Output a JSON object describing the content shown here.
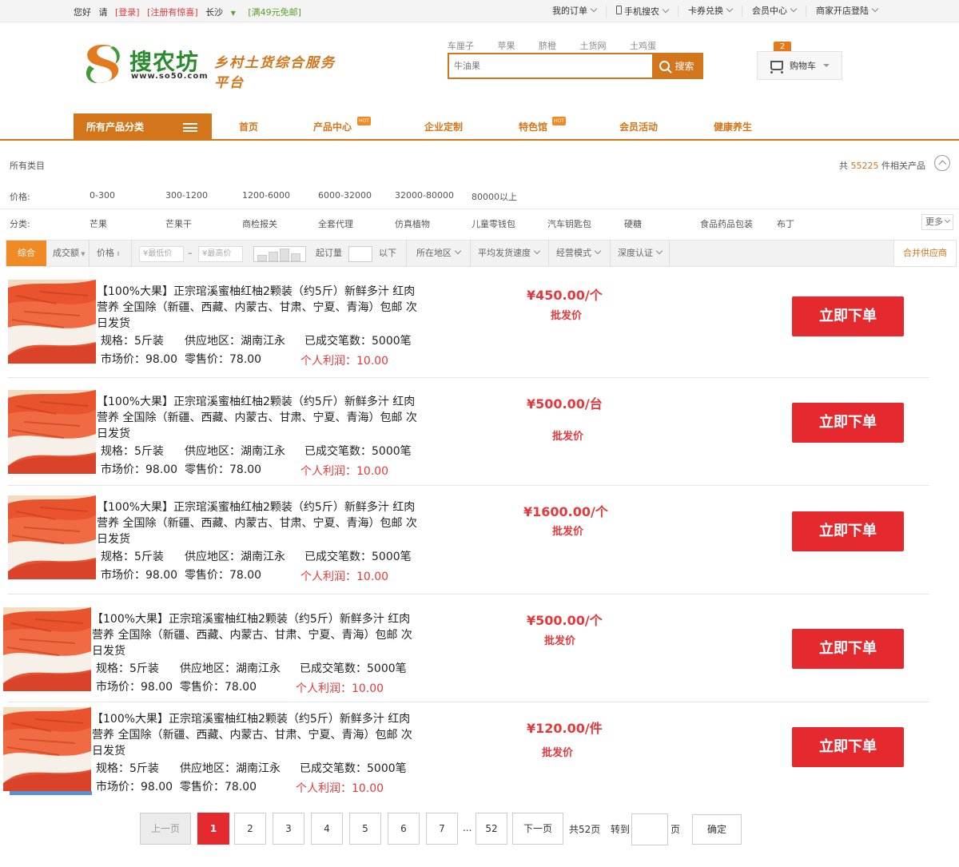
{
  "topbar": {
    "greeting": "您好",
    "please": "请",
    "login": "[登录]",
    "register": "[注册有惊喜]",
    "city": "长沙",
    "promo": "[满49元免邮]",
    "links": [
      "我的订单",
      "手机搜农",
      "卡券兑换",
      "会员中心",
      "商家开店登陆"
    ]
  },
  "brand": {
    "name": "搜农坊",
    "url": "www.so50.com",
    "slogan": "乡村土货综合服务平台"
  },
  "search": {
    "hotwords": [
      "车厘子",
      "苹果",
      "脐橙",
      "土货网",
      "土鸡蛋"
    ],
    "placeholder": "牛油果",
    "button": "搜索"
  },
  "cart": {
    "label": "购物车",
    "count": "2"
  },
  "nav": {
    "all_categories": "所有产品分类",
    "items": [
      "首页",
      "产品中心",
      "企业定制",
      "特色馆",
      "会员活动",
      "健康养生"
    ],
    "hot_badge": "HOT"
  },
  "filters": {
    "all_label": "所有类目",
    "total_prefix": "共",
    "total_count": "55225",
    "total_suffix": "件相关产品",
    "price_label": "价格:",
    "price_ranges": [
      "0-300",
      "300-1200",
      "1200-6000",
      "6000-32000",
      "32000-80000",
      "80000以上"
    ],
    "class_label": "分类:",
    "classes": [
      "芒果",
      "芒果干",
      "商检报关",
      "全套代理",
      "仿真植物",
      "儿童零钱包",
      "汽车钥匙包",
      "硬糖",
      "食品药品包装",
      "布丁"
    ],
    "more": "更多"
  },
  "sortbar": {
    "comprehensive": "综合",
    "volume": "成交额",
    "price": "价格",
    "min_price": "¥最低价",
    "dash": "–",
    "max_price": "¥最高价",
    "moq": "起订量",
    "below": "以下",
    "location": "所在地区",
    "ship_speed": "平均发货速度",
    "mode": "经营模式",
    "cert": "深度认证",
    "merge": "合并供应商"
  },
  "products": [
    {
      "title": "【100%大果】正宗琯溪蜜柚红柚2颗装（约5斤）新鲜多汁 红肉营养 全国除（新疆、西藏、内蒙古、甘肃、宁夏、青海）包邮 次日发货",
      "spec": "规格：5斤装",
      "region": "供应地区：湖南江永",
      "deals": "已成交笔数：5000笔",
      "market": "市场价：98.00",
      "retail": "零售价：78.00",
      "profit": "个人利润：10.00",
      "price": "¥450.00/个",
      "wholesale": "批发价",
      "button": "立即下单"
    },
    {
      "title": "【100%大果】正宗琯溪蜜柚红柚2颗装（约5斤）新鲜多汁 红肉营养 全国除（新疆、西藏、内蒙古、甘肃、宁夏、青海）包邮 次日发货",
      "spec": "规格：5斤装",
      "region": "供应地区：湖南江永",
      "deals": "已成交笔数：5000笔",
      "market": "市场价：98.00",
      "retail": "零售价：78.00",
      "profit": "个人利润：10.00",
      "price": "¥500.00/台",
      "wholesale": "批发价",
      "button": "立即下单"
    },
    {
      "title": "【100%大果】正宗琯溪蜜柚红柚2颗装（约5斤）新鲜多汁 红肉营养 全国除（新疆、西藏、内蒙古、甘肃、宁夏、青海）包邮 次日发货",
      "spec": "规格：5斤装",
      "region": "供应地区：湖南江永",
      "deals": "已成交笔数：5000笔",
      "market": "市场价：98.00",
      "retail": "零售价：78.00",
      "profit": "个人利润：10.00",
      "price": "¥1600.00/个",
      "wholesale": "批发价",
      "button": "立即下单"
    },
    {
      "title": "【100%大果】正宗琯溪蜜柚红柚2颗装（约5斤）新鲜多汁 红肉营养 全国除（新疆、西藏、内蒙古、甘肃、宁夏、青海）包邮 次日发货",
      "spec": "规格：5斤装",
      "region": "供应地区：湖南江永",
      "deals": "已成交笔数：5000笔",
      "market": "市场价：98.00",
      "retail": "零售价：78.00",
      "profit": "个人利润：10.00",
      "price": "¥500.00/个",
      "wholesale": "批发价",
      "button": "立即下单"
    },
    {
      "title": "【100%大果】正宗琯溪蜜柚红柚2颗装（约5斤）新鲜多汁 红肉营养 全国除（新疆、西藏、内蒙古、甘肃、宁夏、青海）包邮 次日发货",
      "spec": "规格：5斤装",
      "region": "供应地区：湖南江永",
      "deals": "已成交笔数：5000笔",
      "market": "市场价：98.00",
      "retail": "零售价：78.00",
      "profit": "个人利润：10.00",
      "price": "¥120.00/件",
      "wholesale": "批发价",
      "button": "立即下单"
    }
  ],
  "pagination": {
    "prev": "上一页",
    "pages": [
      "1",
      "2",
      "3",
      "4",
      "5",
      "6",
      "7"
    ],
    "ellipsis": "...",
    "last": "52",
    "next": "下一页",
    "total": "共52页",
    "goto": "转到",
    "page_unit": "页",
    "confirm": "确定",
    "current": "1"
  },
  "colors": {
    "brand_orange": "#d3751a",
    "accent_red": "#e4292f",
    "price_red": "#e4393c",
    "logo_green": "#2a8a2f"
  }
}
